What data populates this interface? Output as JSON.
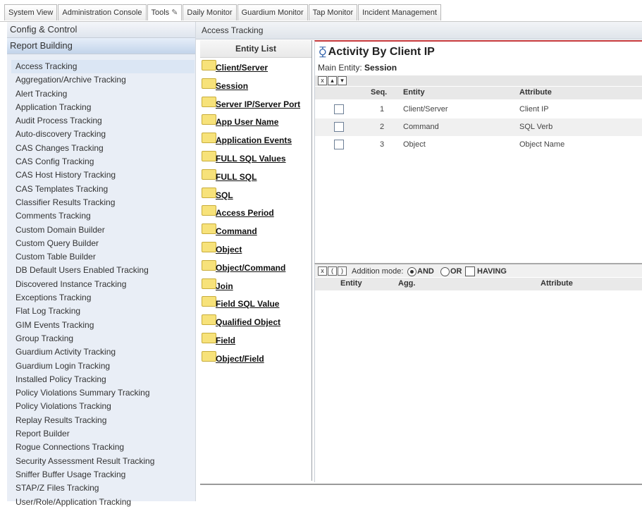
{
  "tabs": [
    {
      "label": "System View",
      "active": false
    },
    {
      "label": "Administration Console",
      "active": false
    },
    {
      "label": "Tools",
      "active": true,
      "icon": "pencil-icon"
    },
    {
      "label": "Daily Monitor",
      "active": false
    },
    {
      "label": "Guardium Monitor",
      "active": false
    },
    {
      "label": "Tap Monitor",
      "active": false
    },
    {
      "label": "Incident Management",
      "active": false
    }
  ],
  "sidebar": {
    "sections": [
      "Config & Control",
      "Report Building"
    ],
    "selected_section": "Report Building",
    "items": [
      "Access Tracking",
      "Aggregation/Archive Tracking",
      "Alert Tracking",
      "Application Tracking",
      "Audit Process Tracking",
      "Auto-discovery Tracking",
      "CAS Changes Tracking",
      "CAS Config Tracking",
      "CAS Host History Tracking",
      "CAS Templates Tracking",
      "Classifier Results Tracking",
      "Comments Tracking",
      "Custom Domain Builder",
      "Custom Query Builder",
      "Custom Table Builder",
      "DB Default Users Enabled Tracking",
      "Discovered Instance Tracking",
      "Exceptions Tracking",
      "Flat Log Tracking",
      "GIM Events Tracking",
      "Group Tracking",
      "Guardium Activity Tracking",
      "Guardium Login Tracking",
      "Installed Policy Tracking",
      "Policy Violations Summary Tracking",
      "Policy Violations Tracking",
      "Replay Results Tracking",
      "Report Builder",
      "Rogue Connections Tracking",
      "Security Assessment Result Tracking",
      "Sniffer Buffer Usage Tracking",
      "STAP/Z Files Tracking",
      "User/Role/Application Tracking"
    ],
    "active_item": "Access Tracking"
  },
  "header": {
    "title": "Access Tracking"
  },
  "entity_list": {
    "title": "Entity List",
    "items": [
      "Client/Server",
      "Session",
      "Server IP/Server Port",
      "App User Name",
      "Application Events",
      "FULL SQL Values",
      "FULL SQL",
      "SQL",
      "Access Period",
      "Command",
      "Object",
      "Object/Command",
      "Join",
      "Field SQL Value",
      "Qualified Object",
      "Field",
      "Object/Field"
    ]
  },
  "report": {
    "title": "Activity By Client IP",
    "main_entity_label": "Main Entity:",
    "main_entity_value": "Session",
    "columns": {
      "seq": "Seq.",
      "entity": "Entity",
      "attribute": "Attribute"
    },
    "rows": [
      {
        "seq": "1",
        "entity": "Client/Server",
        "attribute": "Client IP"
      },
      {
        "seq": "2",
        "entity": "Command",
        "attribute": "SQL Verb"
      },
      {
        "seq": "3",
        "entity": "Object",
        "attribute": "Object Name"
      }
    ]
  },
  "conditions": {
    "addition_mode_label": "Addition mode:",
    "options": [
      "AND",
      "OR"
    ],
    "selected": "AND",
    "having_label": "HAVING",
    "columns": {
      "entity": "Entity",
      "agg": "Agg.",
      "attribute": "Attribute"
    }
  },
  "colors": {
    "accent_red": "#c5383b",
    "selection_blue": "#dbe6f4",
    "folder_yellow": "#f7e27a"
  }
}
